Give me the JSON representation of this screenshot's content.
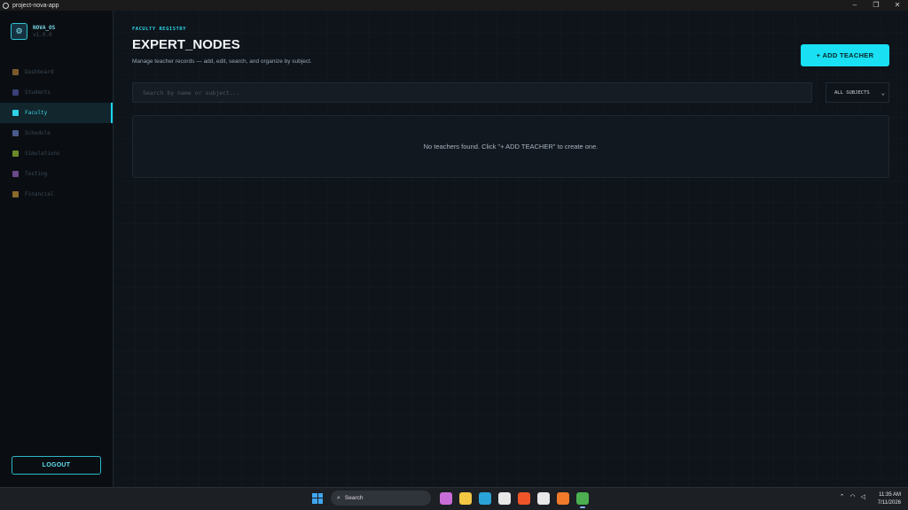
{
  "window": {
    "title": "project-nova-app",
    "controls": [
      "–",
      "❐",
      "✕"
    ]
  },
  "brand": {
    "name": "NOVA_OS",
    "subtitle": "v1.0.0"
  },
  "nav": [
    {
      "label": "Dashboard",
      "icon": "dashboard-icon",
      "color": "#7a5a2a"
    },
    {
      "label": "Students",
      "icon": "students-icon",
      "color": "#3a3f7a"
    },
    {
      "label": "Faculty",
      "icon": "faculty-icon",
      "color": "#2fd2e6",
      "active": true
    },
    {
      "label": "Schedule",
      "icon": "calendar-icon",
      "color": "#4a5a8a"
    },
    {
      "label": "Simulations",
      "icon": "pencil-icon",
      "color": "#6a8a2a"
    },
    {
      "label": "Testing",
      "icon": "document-icon",
      "color": "#6a4a8a"
    },
    {
      "label": "Financial",
      "icon": "money-bag-icon",
      "color": "#8a6a2a"
    }
  ],
  "logout_label": "LOGOUT",
  "header": {
    "eyebrow": "FACULTY REGISTRY",
    "title": "EXPERT_NODES",
    "subtitle": "Manage teacher records — add, edit, search, and organize by subject.",
    "add_button": "+ ADD TEACHER"
  },
  "search": {
    "placeholder": "Search by name or subject...",
    "value": ""
  },
  "subject_filter": {
    "selected": "ALL SUBJECTS"
  },
  "empty_message": "No teachers found. Click \"+ ADD TEACHER\" to create one.",
  "taskbar": {
    "search_label": "Search",
    "apps": [
      {
        "name": "copilot-icon",
        "color": "#c86dd7"
      },
      {
        "name": "file-explorer-icon",
        "color": "#f2c744"
      },
      {
        "name": "edge-icon",
        "color": "#2aa3d8"
      },
      {
        "name": "store-icon",
        "color": "#e8e8e8"
      },
      {
        "name": "brave-icon",
        "color": "#f0552a"
      },
      {
        "name": "app-icon",
        "color": "#e8e8e8"
      },
      {
        "name": "firefox-icon",
        "color": "#f07a2a"
      },
      {
        "name": "chrome-icon",
        "color": "#4caf50",
        "active": true
      }
    ],
    "time": "11:35 AM",
    "date": "7/11/2026"
  }
}
